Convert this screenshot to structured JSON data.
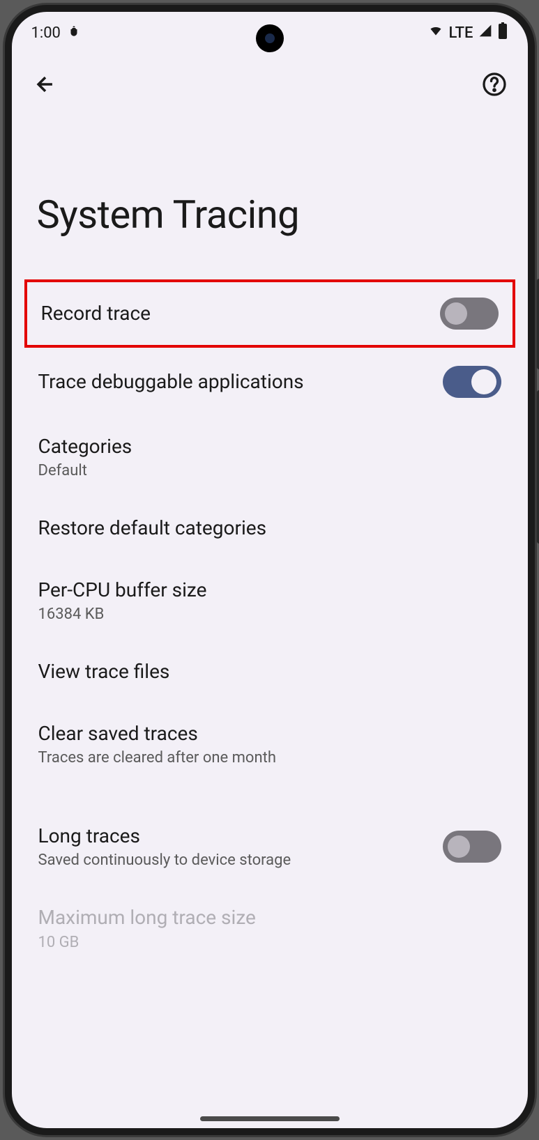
{
  "status": {
    "time": "1:00",
    "network": "LTE"
  },
  "page": {
    "title": "System Tracing"
  },
  "rows": {
    "record_trace": {
      "title": "Record trace"
    },
    "trace_debuggable": {
      "title": "Trace debuggable applications"
    },
    "categories": {
      "title": "Categories",
      "subtitle": "Default"
    },
    "restore_default": {
      "title": "Restore default categories"
    },
    "buffer_size": {
      "title": "Per-CPU buffer size",
      "subtitle": "16384 KB"
    },
    "view_trace": {
      "title": "View trace files"
    },
    "clear_traces": {
      "title": "Clear saved traces",
      "subtitle": "Traces are cleared after one month"
    },
    "long_traces": {
      "title": "Long traces",
      "subtitle": "Saved continuously to device storage"
    },
    "max_size": {
      "title": "Maximum long trace size",
      "subtitle": "10 GB"
    }
  }
}
